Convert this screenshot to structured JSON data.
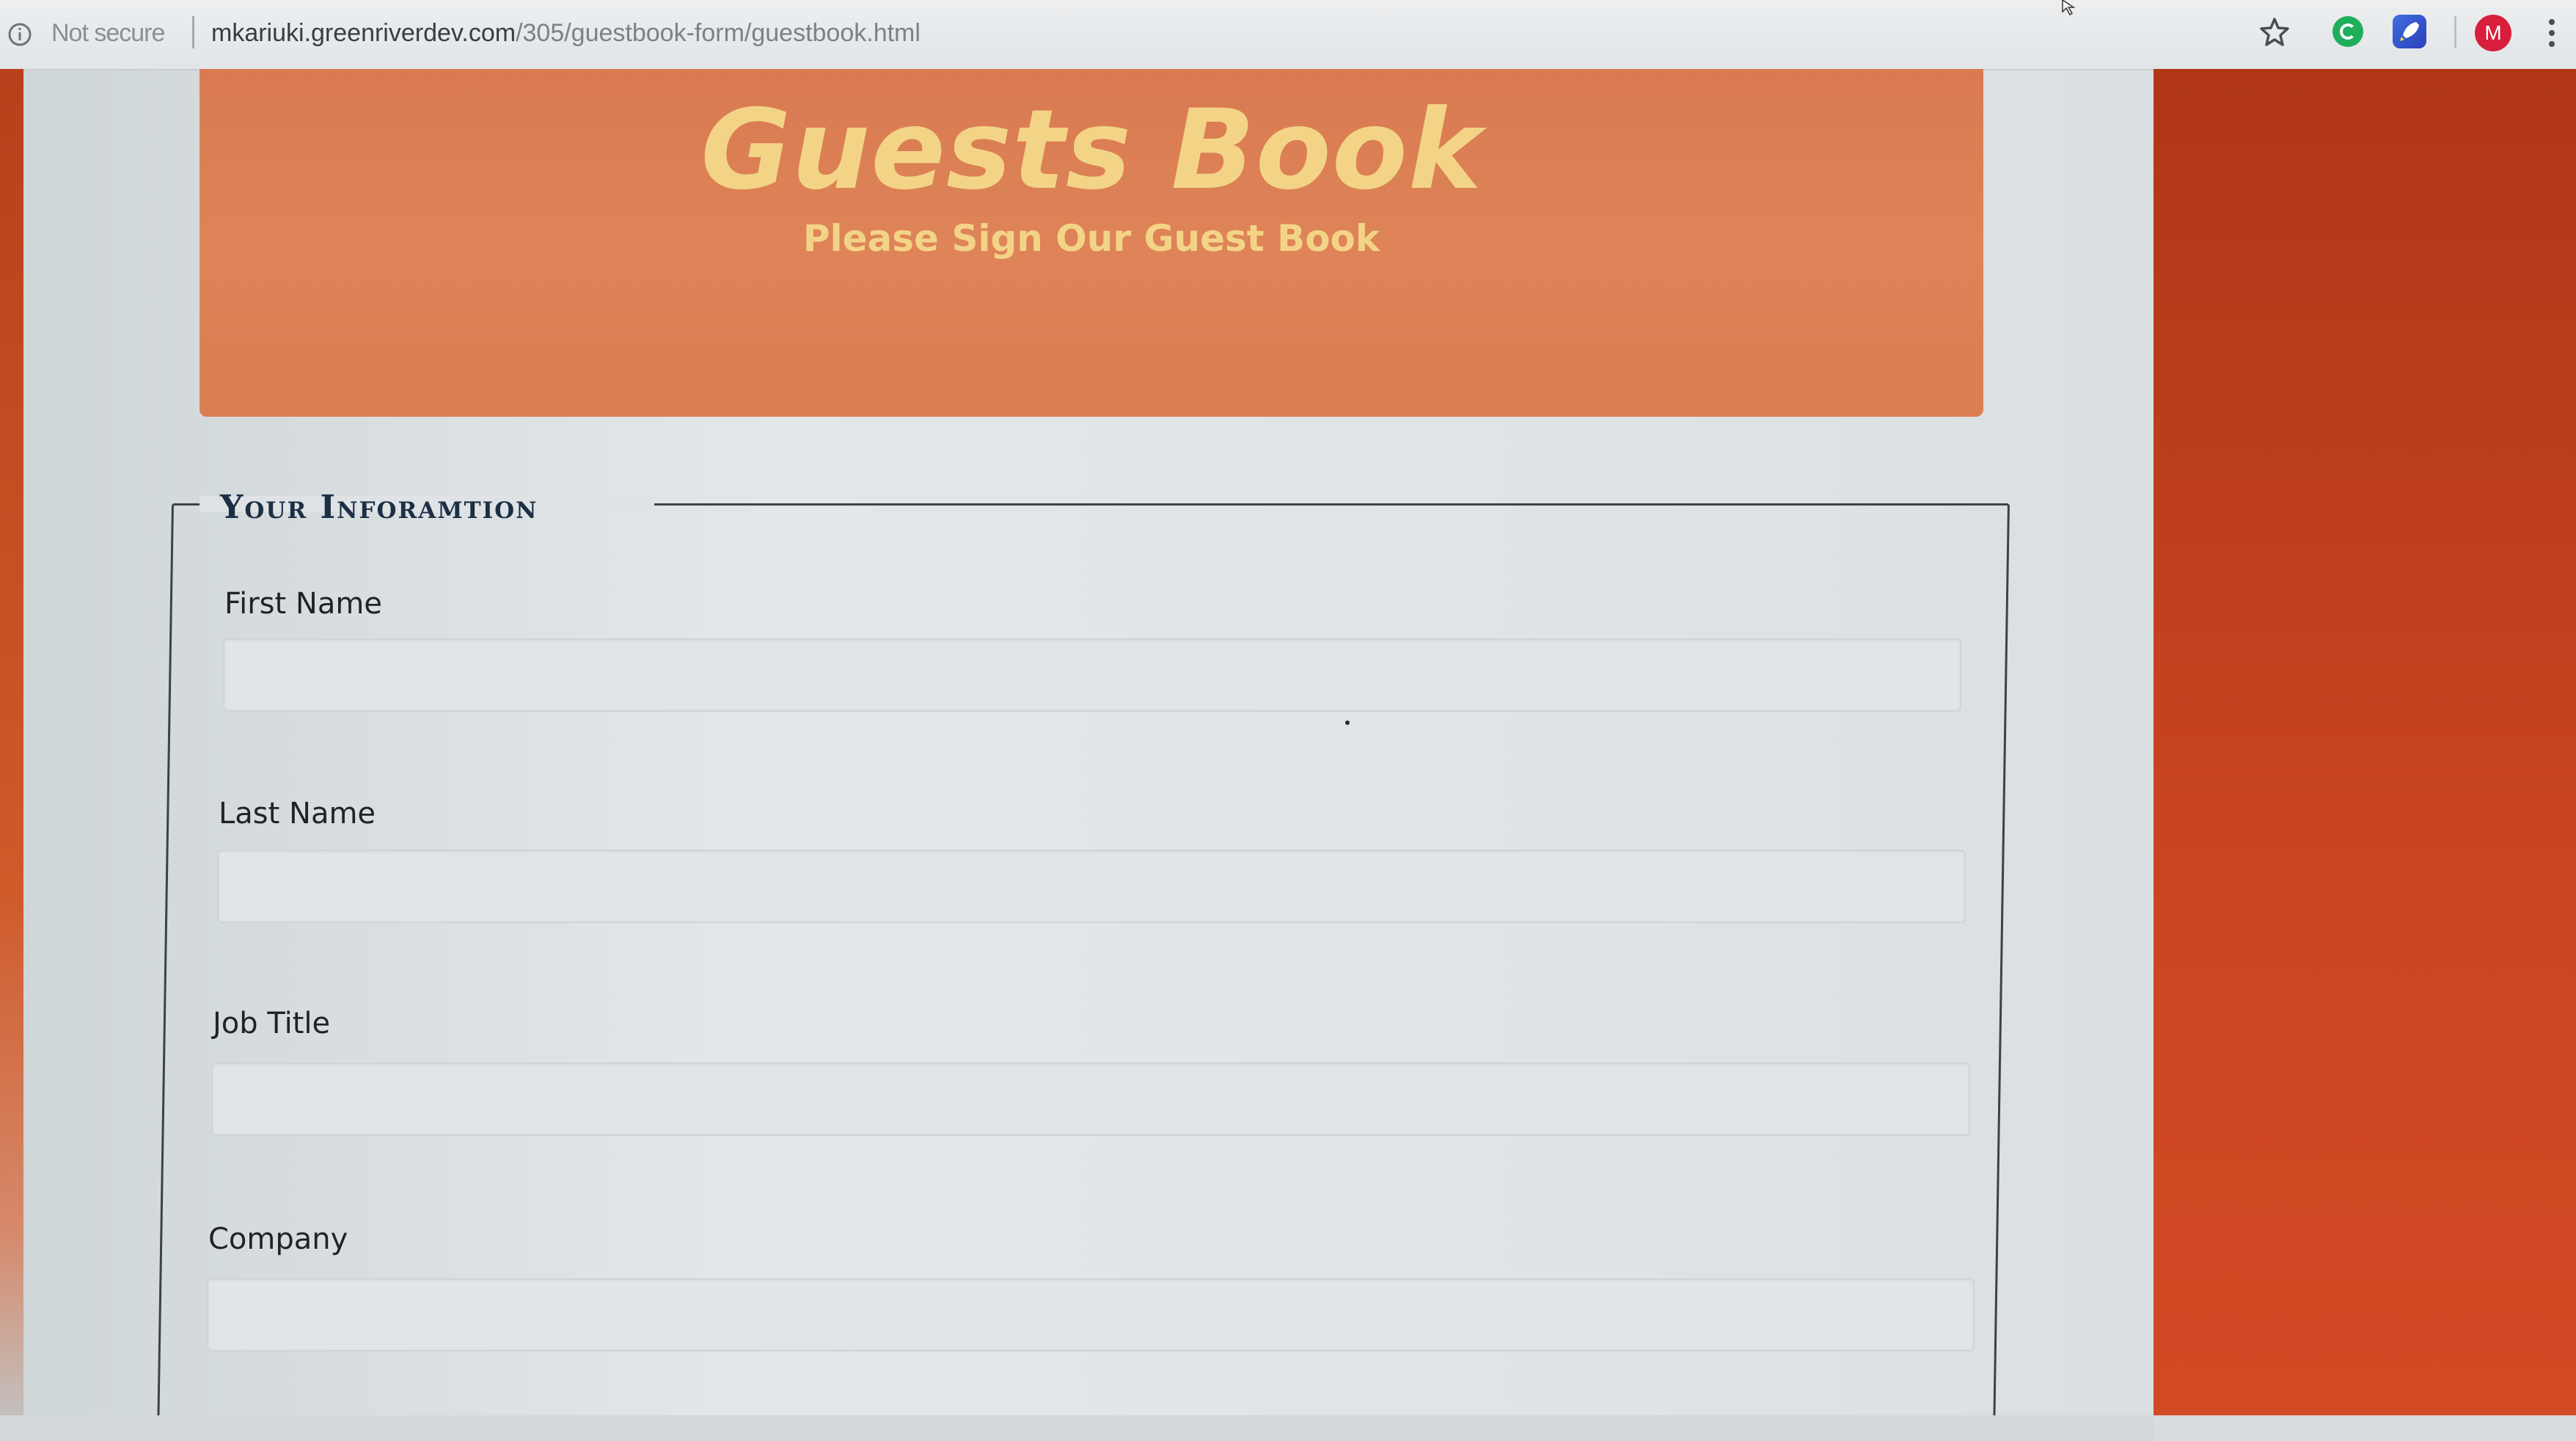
{
  "browser": {
    "security_label": "Not secure",
    "url_host": "mkariuki.greenriverdev.com",
    "url_path": "/305/guestbook-form/guestbook.html",
    "profile_initial": "M"
  },
  "header": {
    "title": "Guests Book",
    "subtitle": "Please Sign Our Guest Book"
  },
  "form": {
    "legend": "Your Inforamtion",
    "fields": [
      {
        "label": "First Name",
        "value": ""
      },
      {
        "label": "Last Name",
        "value": ""
      },
      {
        "label": "Job Title",
        "value": ""
      },
      {
        "label": "Company",
        "value": ""
      }
    ]
  },
  "colors": {
    "banner": "#dd8055",
    "title_text": "#f3d487",
    "sidebar": "#c2401d",
    "legend_text": "#1c2f45"
  }
}
